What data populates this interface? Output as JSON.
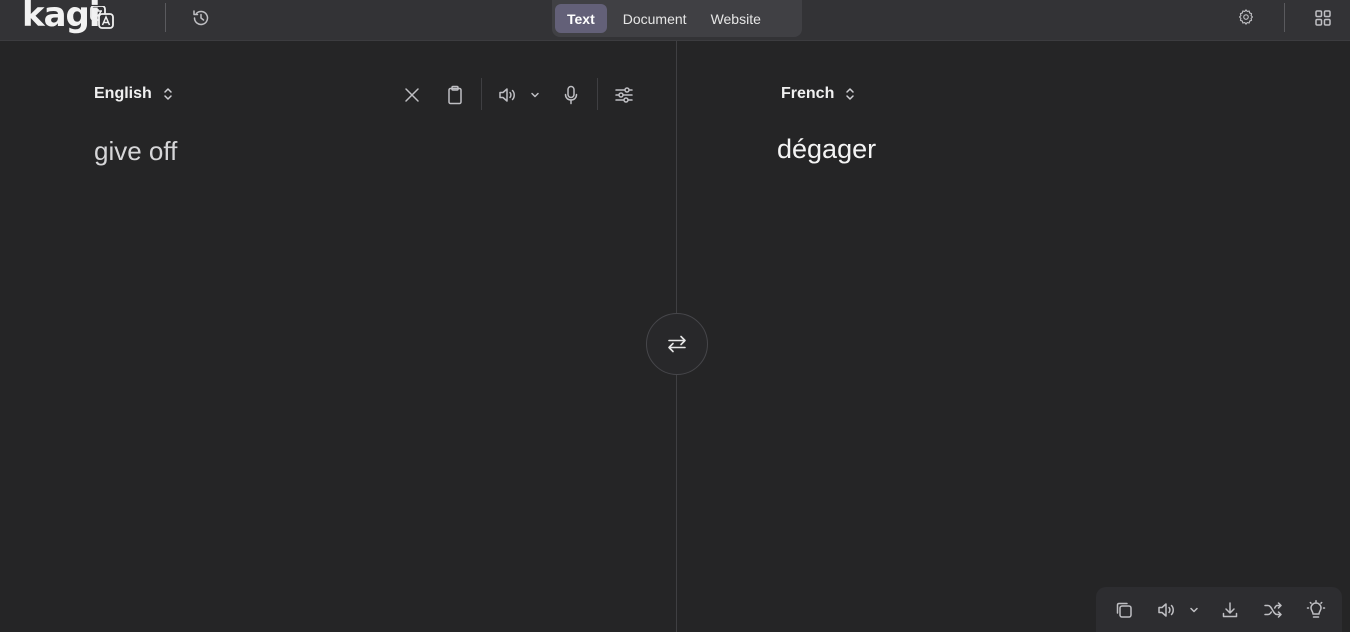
{
  "header": {
    "logo_text": "kagi",
    "tabs": [
      {
        "label": "Text",
        "active": true
      },
      {
        "label": "Document",
        "active": false
      },
      {
        "label": "Website",
        "active": false
      }
    ]
  },
  "source": {
    "language": "English",
    "text": "give off"
  },
  "target": {
    "language": "French",
    "text": "dégager"
  },
  "colors": {
    "background": "#252526",
    "header": "#333336",
    "active_tab": "#636078"
  },
  "icons": {
    "header": [
      "translate-icon",
      "history-icon",
      "settings-gear-icon",
      "apps-grid-icon"
    ],
    "source_toolbar": [
      "clear-icon",
      "clipboard-icon",
      "speaker-icon",
      "chevron-down-icon",
      "microphone-icon",
      "sliders-icon"
    ],
    "swap": "swap-arrows-icon",
    "output_toolbar": [
      "copy-icon",
      "speaker-icon",
      "chevron-down-icon",
      "download-icon",
      "shuffle-icon",
      "lightbulb-icon"
    ]
  }
}
